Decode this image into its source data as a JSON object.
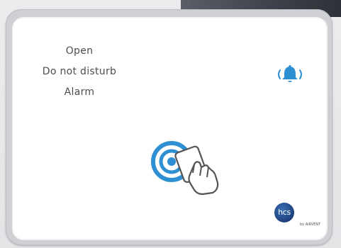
{
  "status": {
    "items": [
      "Open",
      "Do not disturb",
      "Alarm"
    ]
  },
  "icons": {
    "alarm": "bell-ringing-icon",
    "card_reader": "contactless-card-icon"
  },
  "brand": {
    "logo_text": "hcs",
    "logo_subtext": "by AIRVENT"
  },
  "colors": {
    "accent": "#2f8fd3",
    "text": "#4d4d4f",
    "panel": "#ffffff",
    "logo": "#1d3f7a"
  }
}
